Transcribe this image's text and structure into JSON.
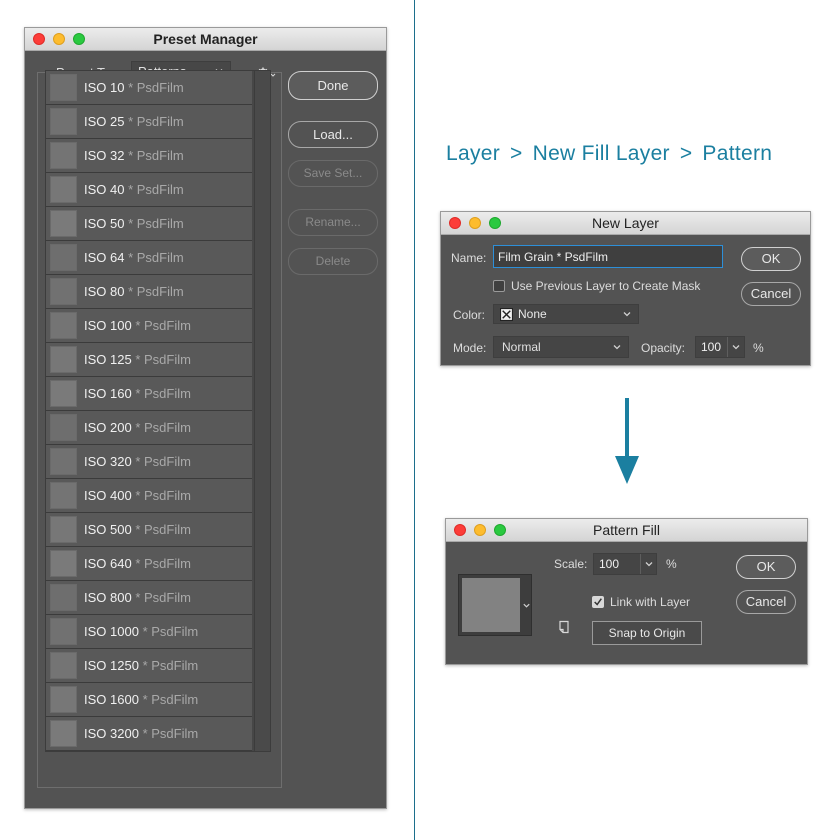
{
  "preset_manager": {
    "title": "Preset Manager",
    "preset_type_label": "Preset Type:",
    "preset_type_value": "Patterns",
    "buttons": {
      "done": "Done",
      "load": "Load...",
      "save_set": "Save Set...",
      "rename": "Rename...",
      "delete": "Delete"
    },
    "items": [
      {
        "name": "ISO 10",
        "suffix": "* PsdFilm"
      },
      {
        "name": "ISO 25",
        "suffix": "* PsdFilm"
      },
      {
        "name": "ISO 32",
        "suffix": "* PsdFilm"
      },
      {
        "name": "ISO 40",
        "suffix": "* PsdFilm"
      },
      {
        "name": "ISO 50",
        "suffix": "* PsdFilm"
      },
      {
        "name": "ISO 64",
        "suffix": "* PsdFilm"
      },
      {
        "name": "ISO 80",
        "suffix": "* PsdFilm"
      },
      {
        "name": "ISO 100",
        "suffix": "* PsdFilm"
      },
      {
        "name": "ISO 125",
        "suffix": "* PsdFilm"
      },
      {
        "name": "ISO 160",
        "suffix": "* PsdFilm"
      },
      {
        "name": "ISO 200",
        "suffix": "* PsdFilm"
      },
      {
        "name": "ISO 320",
        "suffix": "* PsdFilm"
      },
      {
        "name": "ISO 400",
        "suffix": "* PsdFilm"
      },
      {
        "name": "ISO 500",
        "suffix": "* PsdFilm"
      },
      {
        "name": "ISO 640",
        "suffix": "* PsdFilm"
      },
      {
        "name": "ISO 800",
        "suffix": "* PsdFilm"
      },
      {
        "name": "ISO 1000",
        "suffix": "* PsdFilm"
      },
      {
        "name": "ISO 1250",
        "suffix": "* PsdFilm"
      },
      {
        "name": "ISO 1600",
        "suffix": "* PsdFilm"
      },
      {
        "name": "ISO 3200",
        "suffix": "* PsdFilm"
      }
    ]
  },
  "breadcrumb": {
    "step1": "Layer",
    "step2": "New Fill Layer",
    "step3": "Pattern",
    "separator": ">"
  },
  "new_layer": {
    "title": "New Layer",
    "name_label": "Name:",
    "name_value": "Film Grain * PsdFilm",
    "use_previous_label": "Use Previous Layer to Create  Mask",
    "color_label": "Color:",
    "color_value": "None",
    "mode_label": "Mode:",
    "mode_value": "Normal",
    "opacity_label": "Opacity:",
    "opacity_value": "100",
    "percent": "%",
    "ok": "OK",
    "cancel": "Cancel"
  },
  "pattern_fill": {
    "title": "Pattern Fill",
    "scale_label": "Scale:",
    "scale_value": "100",
    "percent": "%",
    "link_label": "Link with Layer",
    "snap_label": "Snap to Origin",
    "ok": "OK",
    "cancel": "Cancel"
  },
  "colors": {
    "accent": "#1b7fa0",
    "panel": "#535353"
  }
}
